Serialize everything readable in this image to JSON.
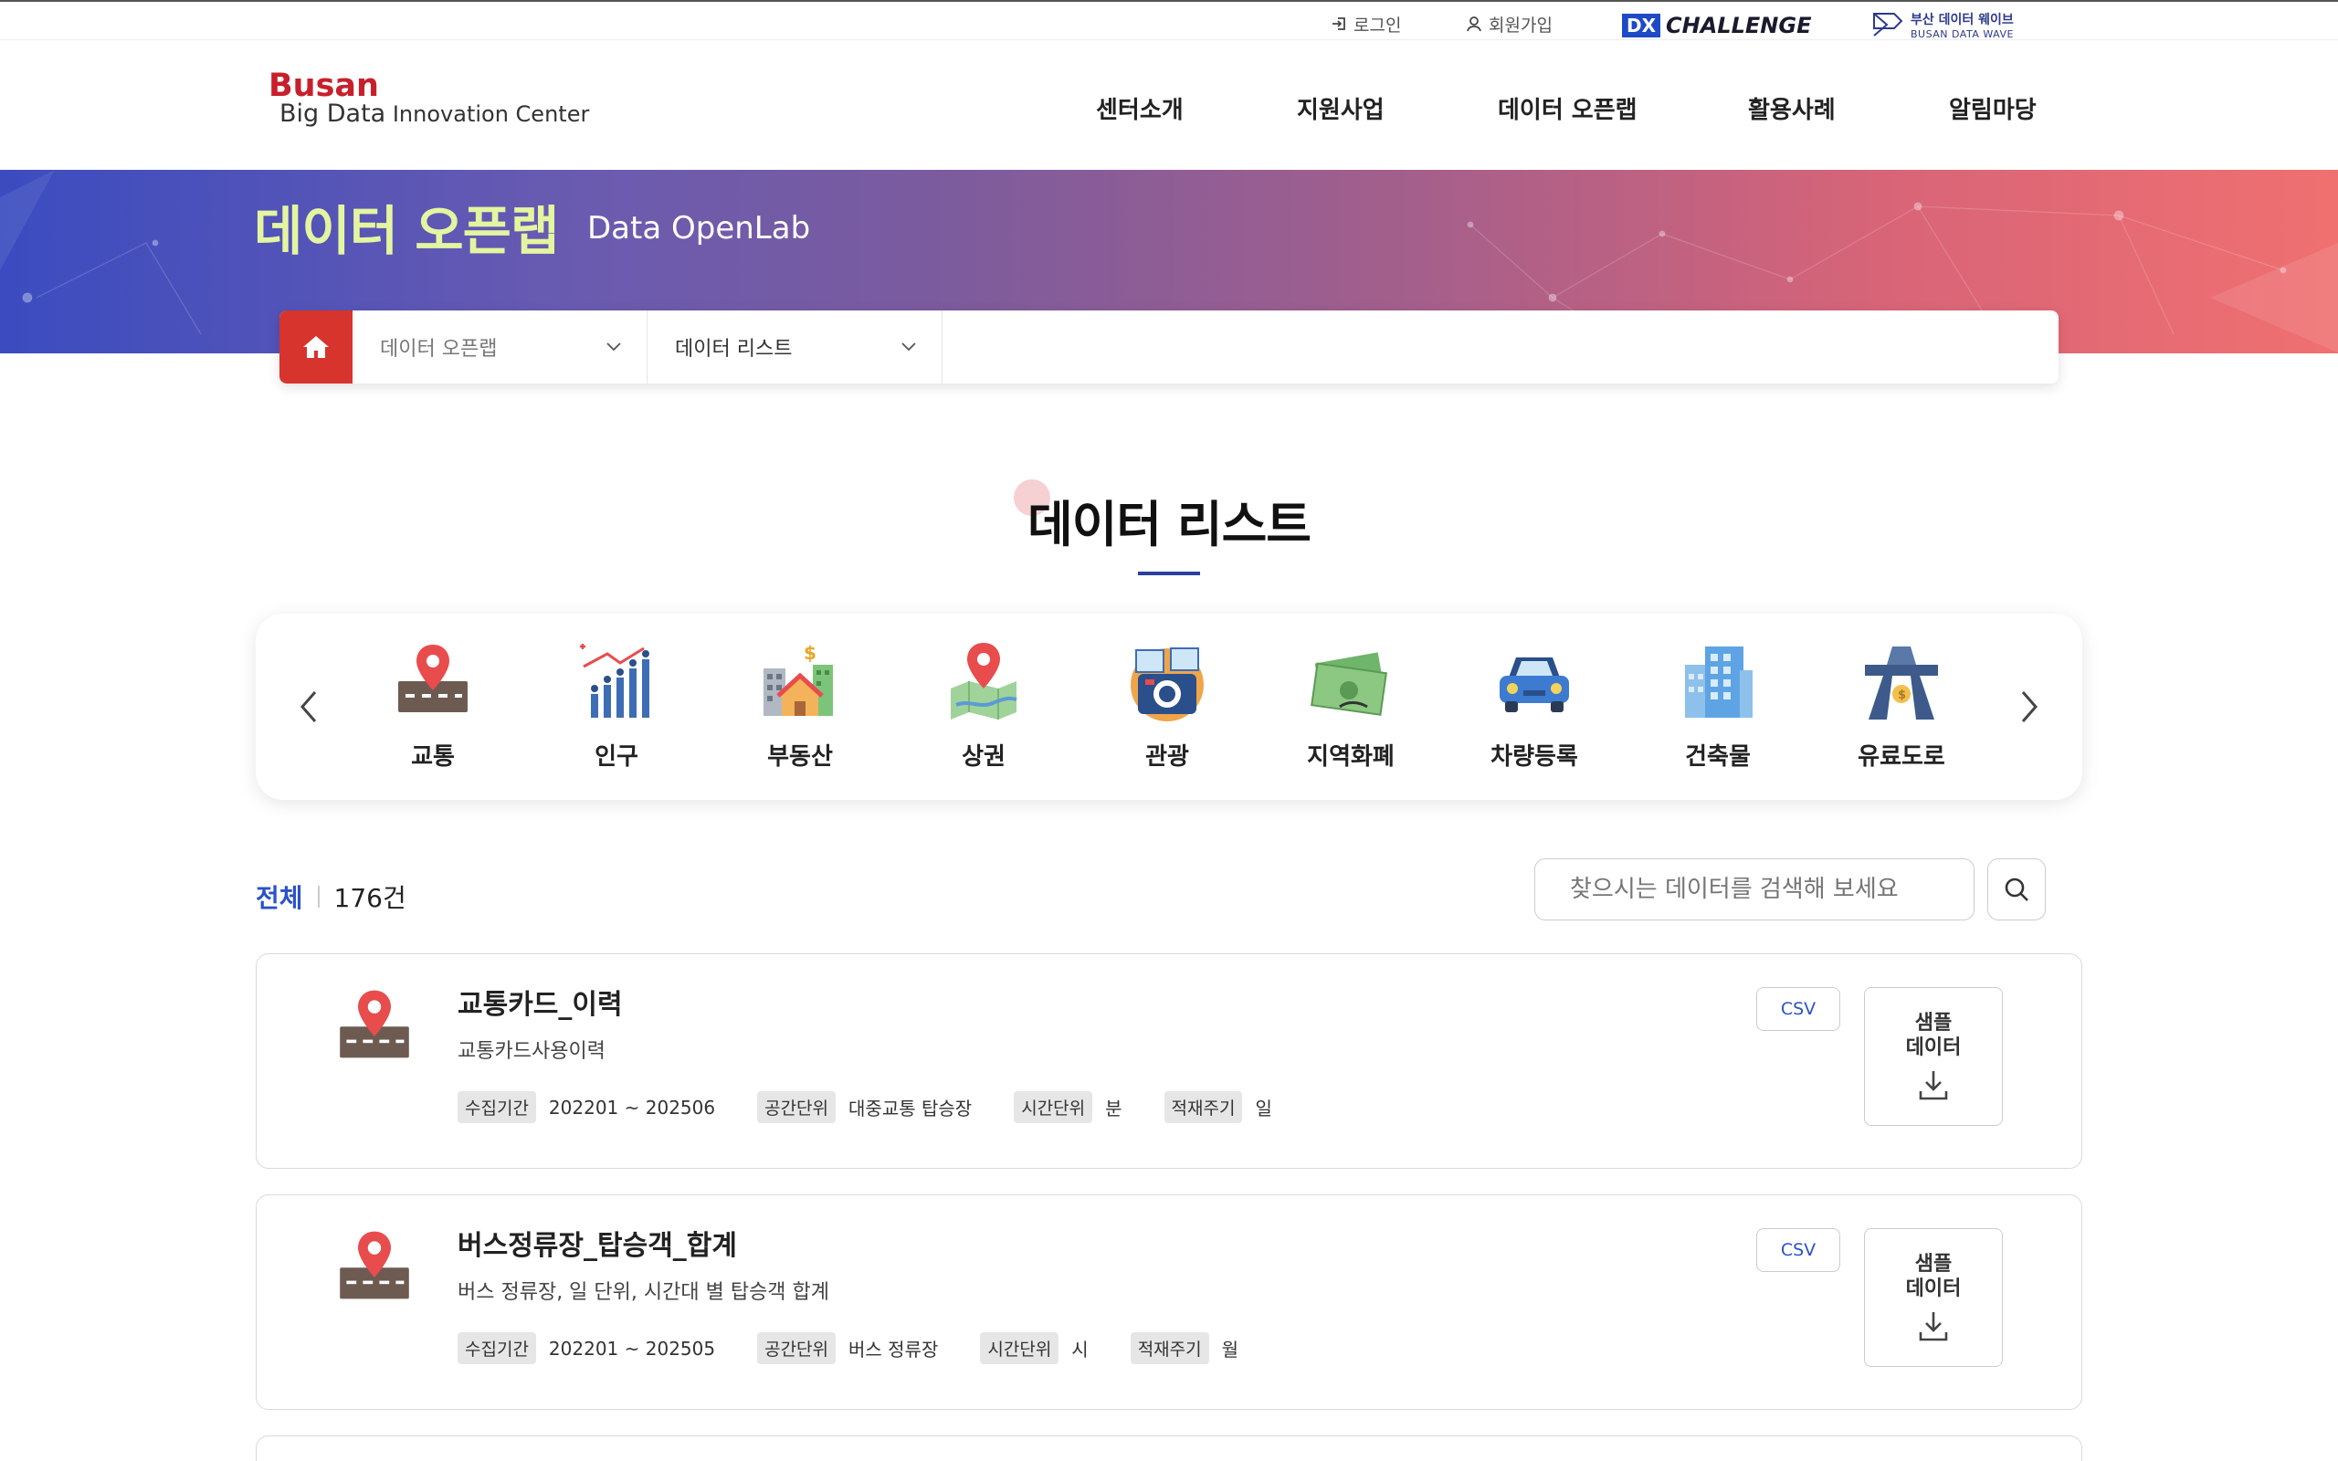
{
  "utility": {
    "login": "로그인",
    "signup": "회원가입",
    "dx_box": "DX",
    "dx_text": "CHALLENGE",
    "wave_kr": "부산 데이터 웨이브",
    "wave_en": "BUSAN DATA WAVE"
  },
  "logo": {
    "line1": "Busan",
    "line2a": "Big Data",
    "line2b": " Innovation Center"
  },
  "nav": [
    "센터소개",
    "지원사업",
    "데이터 오픈랩",
    "활용사례",
    "알림마당"
  ],
  "banner": {
    "title": "데이터 오픈랩",
    "subtitle": "Data OpenLab"
  },
  "breadcrumb": {
    "level1": "데이터 오픈랩",
    "level2": "데이터 리스트"
  },
  "section_title": "데이터 리스트",
  "categories": [
    {
      "label": "교통",
      "icon": "traffic-pin-icon"
    },
    {
      "label": "인구",
      "icon": "population-chart-icon"
    },
    {
      "label": "부동산",
      "icon": "real-estate-icon"
    },
    {
      "label": "상권",
      "icon": "commercial-map-icon"
    },
    {
      "label": "관광",
      "icon": "tourism-camera-icon"
    },
    {
      "label": "지역화폐",
      "icon": "local-currency-icon"
    },
    {
      "label": "차량등록",
      "icon": "car-icon"
    },
    {
      "label": "건축물",
      "icon": "building-icon"
    },
    {
      "label": "유료도로",
      "icon": "toll-road-icon"
    }
  ],
  "list": {
    "all_label": "전체",
    "count": "176건",
    "search_placeholder": "찾으시는 데이터를 검색해 보세요"
  },
  "meta_labels": {
    "period": "수집기간",
    "space": "공간단위",
    "time": "시간단위",
    "cycle": "적재주기"
  },
  "cards": [
    {
      "title": "교통카드_이력",
      "desc": "교통카드사용이력",
      "period": "202201 ~ 202506",
      "space": "대중교통 탑승장",
      "time": "분",
      "cycle": "일",
      "format": "CSV",
      "sample_line1": "샘플",
      "sample_line2": "데이터"
    },
    {
      "title": "버스정류장_탑승객_합계",
      "desc": "버스 정류장, 일 단위, 시간대 별 탑승객 합계",
      "period": "202201 ~ 202505",
      "space": "버스 정류장",
      "time": "시",
      "cycle": "월",
      "format": "CSV",
      "sample_line1": "샘플",
      "sample_line2": "데이터"
    }
  ],
  "colors": {
    "brand_red": "#c8202b",
    "accent_blue": "#2a52c9",
    "banner_title": "#e4f5a0"
  }
}
